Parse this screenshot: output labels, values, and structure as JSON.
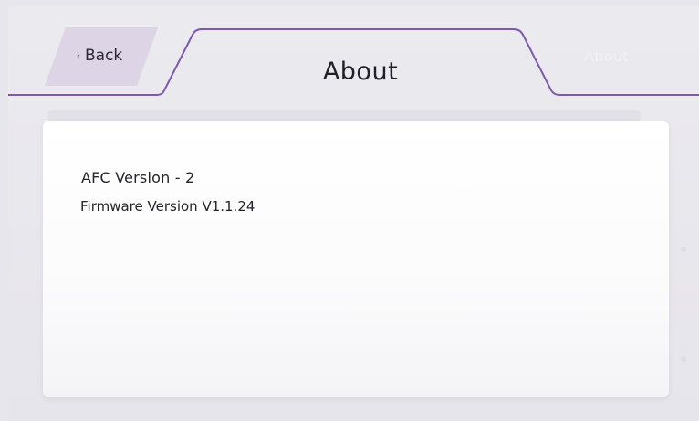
{
  "header": {
    "back_chevron": "‹",
    "back_label": "Back",
    "title": "About",
    "next_tab_label": "About"
  },
  "about": {
    "afc_version": "AFC Version - 2",
    "firmware_version": "Firmware Version V1.1.24"
  },
  "colors": {
    "accent": "#6b3fa0",
    "back_fill": "#ddd4e6",
    "background": "#e7e6ec",
    "card": "#ffffff"
  }
}
